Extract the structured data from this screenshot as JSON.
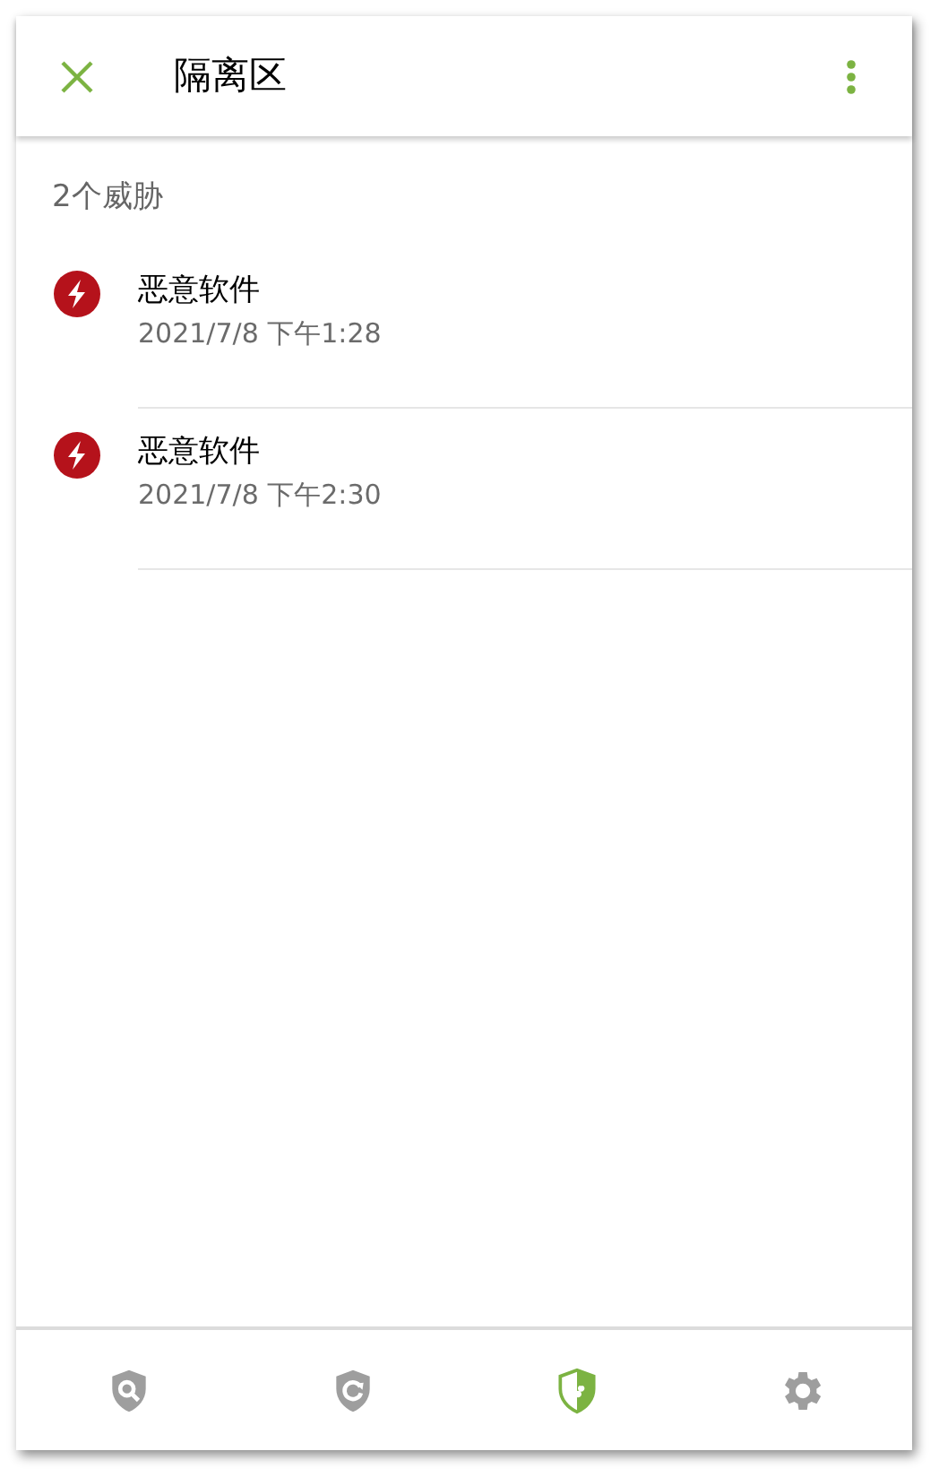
{
  "header": {
    "title": "隔离区"
  },
  "summary": "2个威胁",
  "threats": [
    {
      "name": "恶意软件",
      "time": "2021/7/8 下午1:28"
    },
    {
      "name": "恶意软件",
      "time": "2021/7/8 下午2:30"
    }
  ],
  "nav": [
    {
      "kind": "scan",
      "selected": false
    },
    {
      "kind": "update",
      "selected": false
    },
    {
      "kind": "quarantine",
      "selected": true
    },
    {
      "kind": "settings",
      "selected": false
    }
  ]
}
